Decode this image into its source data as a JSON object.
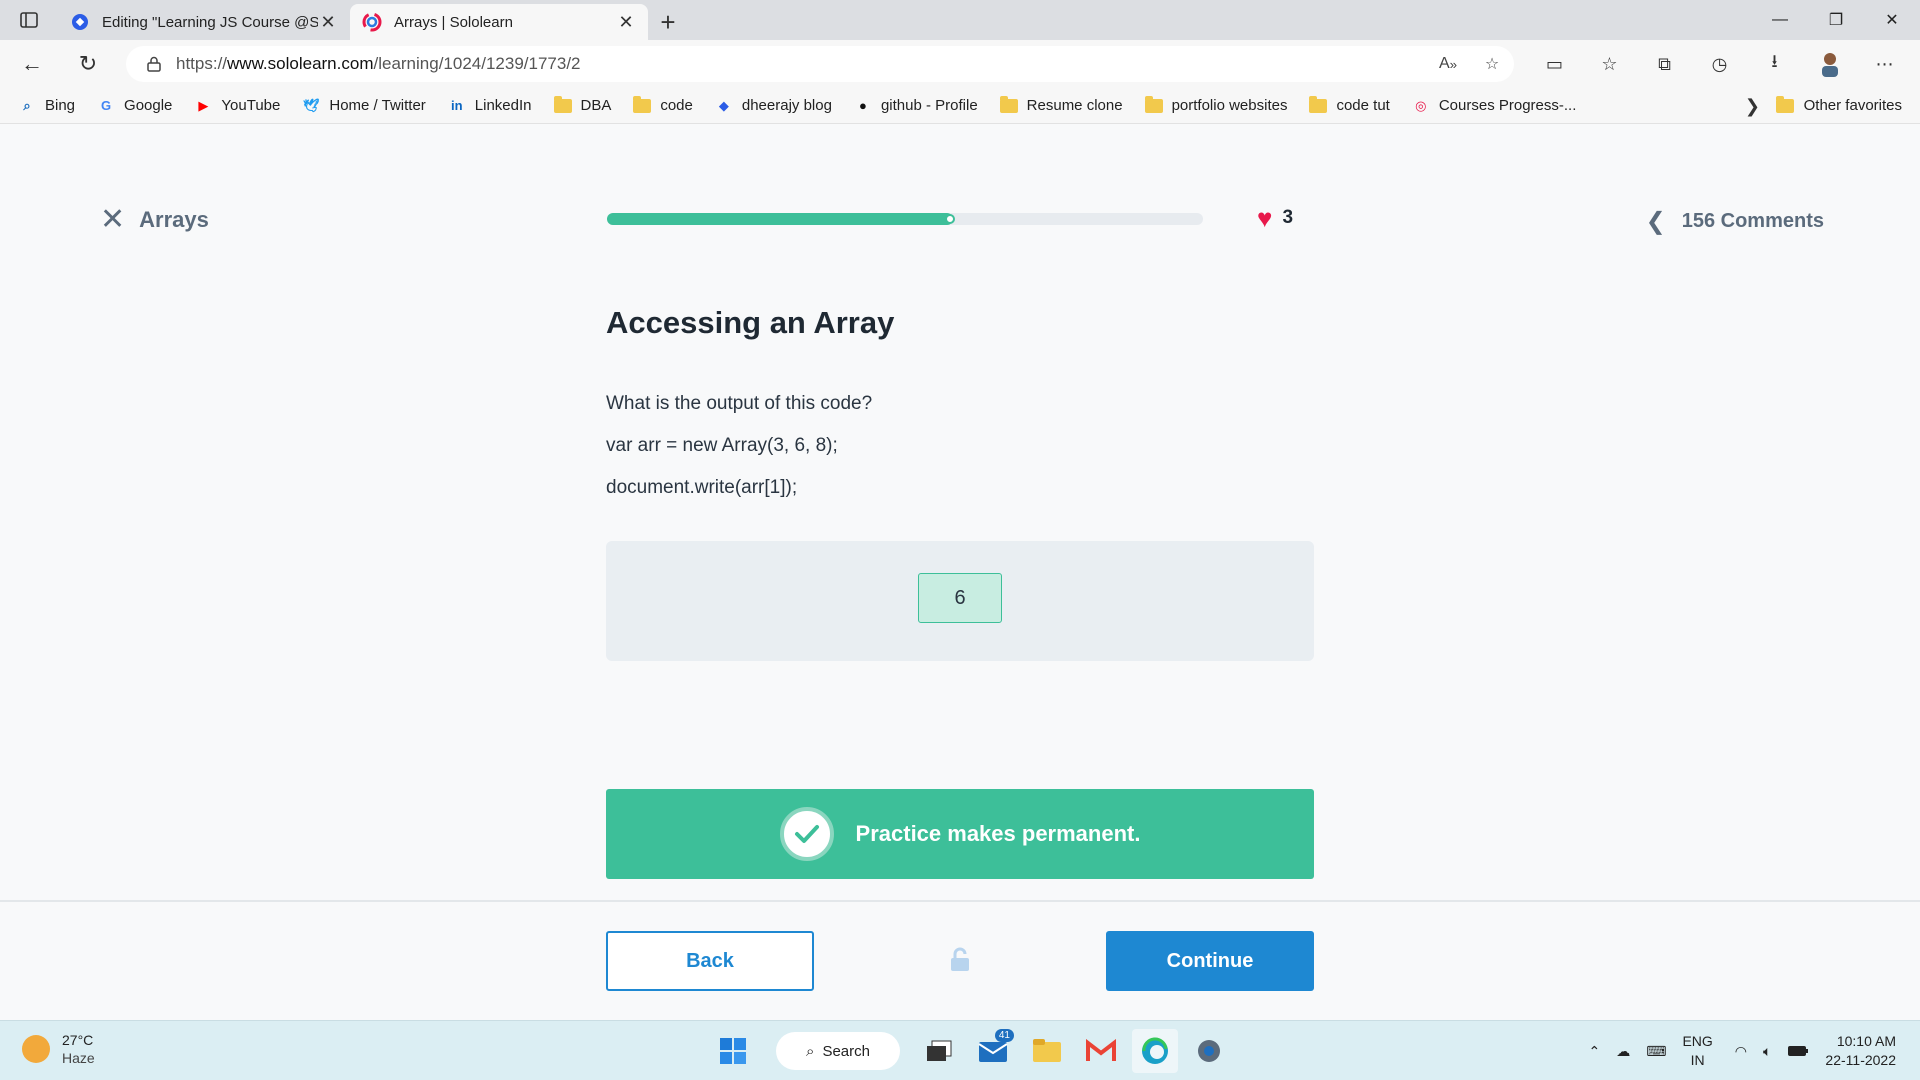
{
  "browser": {
    "tabs": [
      {
        "title": "Editing \"Learning JS Course @Sc",
        "active": false
      },
      {
        "title": "Arrays | Sololearn",
        "active": true
      }
    ],
    "url_prefix": "https://",
    "url_host": "www.sololearn.com",
    "url_path": "/learning/1024/1239/1773/2",
    "bookmarks": [
      {
        "label": "Bing",
        "icon": "bing-icon"
      },
      {
        "label": "Google",
        "icon": "google-icon"
      },
      {
        "label": "YouTube",
        "icon": "youtube-icon"
      },
      {
        "label": "Home / Twitter",
        "icon": "twitter-icon"
      },
      {
        "label": "LinkedIn",
        "icon": "linkedin-icon"
      },
      {
        "label": "DBA",
        "icon": "folder-icon"
      },
      {
        "label": "code",
        "icon": "folder-icon"
      },
      {
        "label": "dheerajy blog",
        "icon": "blog-icon"
      },
      {
        "label": "github - Profile",
        "icon": "github-icon"
      },
      {
        "label": "Resume clone",
        "icon": "folder-icon"
      },
      {
        "label": "portfolio websites",
        "icon": "folder-icon"
      },
      {
        "label": "code tut",
        "icon": "folder-icon"
      },
      {
        "label": "Courses Progress-...",
        "icon": "sololearn-icon"
      }
    ],
    "other_favorites": "Other favorites"
  },
  "lesson": {
    "module": "Arrays",
    "progress_percent": 58,
    "lives": "3",
    "comments": "156 Comments",
    "title": "Accessing an Array",
    "question": "What is the output of this code?",
    "code_line_1": "var arr = new Array(3, 6, 8);",
    "code_line_2": "document.write(arr[1]);",
    "answer": "6",
    "feedback": "Practice makes permanent.",
    "back_label": "Back",
    "continue_label": "Continue",
    "colors": {
      "accent": "#3dbf99",
      "primary": "#1e88d2",
      "heart": "#e8194b"
    }
  },
  "taskbar": {
    "temperature": "27°C",
    "weather": "Haze",
    "search_label": "Search",
    "mail_badge": "41",
    "lang_1": "ENG",
    "lang_2": "IN",
    "time": "10:10 AM",
    "date": "22-11-2022"
  }
}
